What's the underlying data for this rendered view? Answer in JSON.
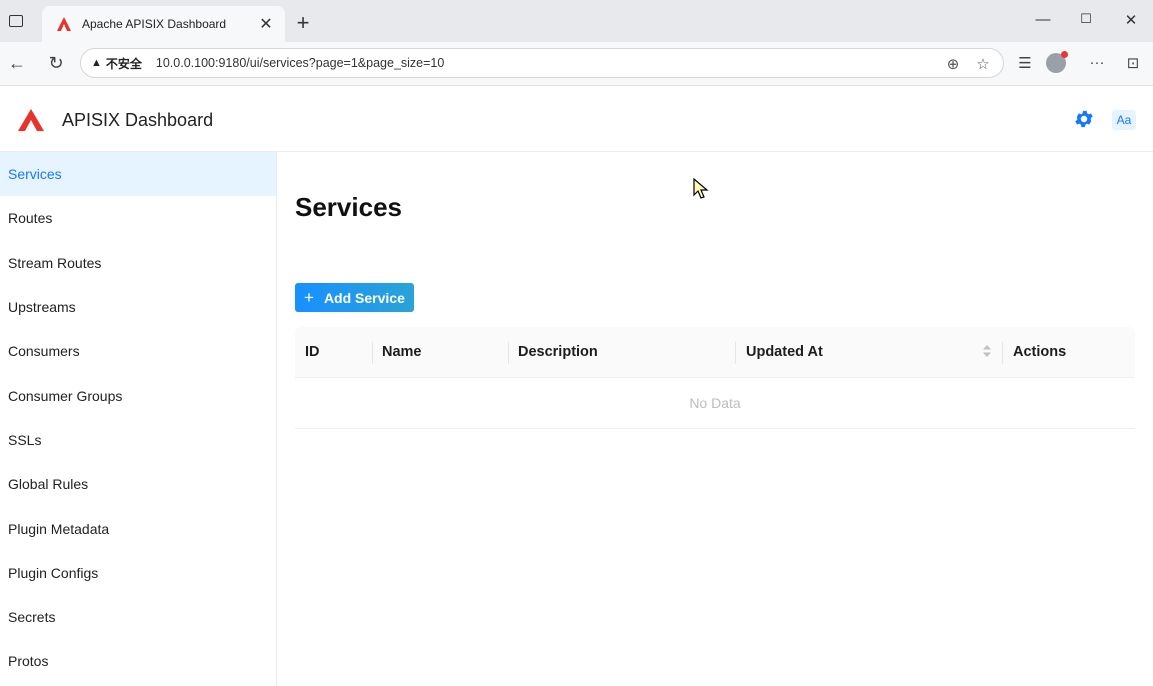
{
  "browser": {
    "tab_title": "Apache APISIX Dashboard",
    "new_tab": "+",
    "security_label": "不安全",
    "url": "10.0.0.100:9180/ui/services?page=1&page_size=10",
    "window_controls": [
      "—",
      "☐",
      "✕"
    ]
  },
  "header": {
    "app_title": "APISIX Dashboard",
    "lang_badge": "Aa"
  },
  "sidebar": {
    "items": [
      {
        "label": "Services",
        "active": true
      },
      {
        "label": "Routes"
      },
      {
        "label": "Stream Routes"
      },
      {
        "label": "Upstreams"
      },
      {
        "label": "Consumers"
      },
      {
        "label": "Consumer Groups"
      },
      {
        "label": "SSLs"
      },
      {
        "label": "Global Rules"
      },
      {
        "label": "Plugin Metadata"
      },
      {
        "label": "Plugin Configs"
      },
      {
        "label": "Secrets"
      },
      {
        "label": "Protos"
      }
    ]
  },
  "main": {
    "title": "Services",
    "add_button": "Add Service",
    "table": {
      "columns": [
        "ID",
        "Name",
        "Description",
        "Updated At",
        "Actions"
      ],
      "empty_text": "No Data"
    }
  },
  "colors": {
    "accent": "#1677ff",
    "active_bg": "#e6f4ff",
    "logo_red": "#e8322c"
  }
}
